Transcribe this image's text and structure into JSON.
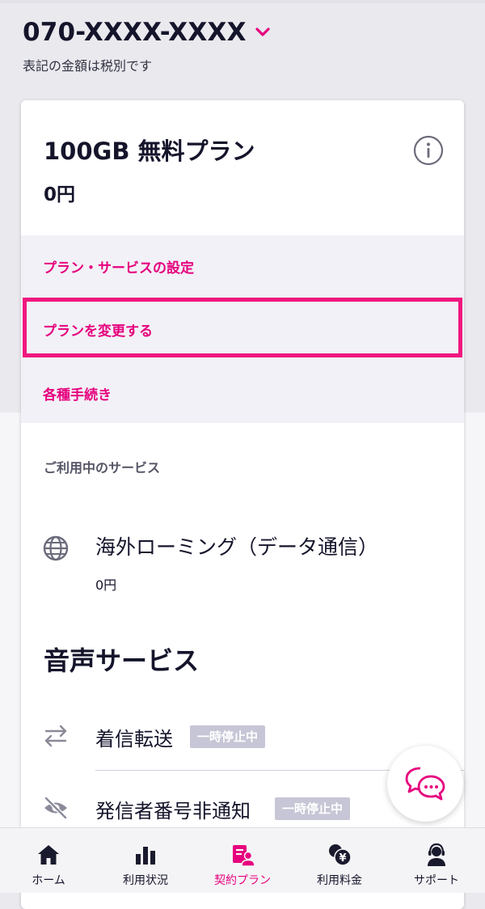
{
  "header": {
    "phone_number": "070-XXXX-XXXX",
    "tax_note": "表記の金額は税別です"
  },
  "plan": {
    "name": "100GB 無料プラン",
    "price": "0円"
  },
  "menu": {
    "items": [
      {
        "label": "プラン・サービスの設定"
      },
      {
        "label": "プランを変更する"
      },
      {
        "label": "各種手続き"
      }
    ],
    "highlighted_index": 1
  },
  "services": {
    "section_label": "ご利用中のサービス",
    "roaming": {
      "name": "海外ローミング（データ通信）",
      "price": "0円"
    }
  },
  "voice": {
    "title": "音声サービス",
    "items": [
      {
        "name": "着信転送",
        "badge": "一時停止中",
        "icon": "arrows-swap-icon"
      },
      {
        "name": "発信者番号非通知",
        "badge": "一時停止中",
        "icon": "eye-off-icon"
      }
    ]
  },
  "bottom_nav": {
    "items": [
      {
        "label": "ホーム",
        "icon": "home-icon"
      },
      {
        "label": "利用状況",
        "icon": "bar-chart-icon"
      },
      {
        "label": "契約プラン",
        "icon": "contract-icon"
      },
      {
        "label": "利用料金",
        "icon": "yen-coins-icon"
      },
      {
        "label": "サポート",
        "icon": "support-agent-icon"
      }
    ],
    "active_index": 2
  },
  "colors": {
    "accent": "#e6007e",
    "highlight_border": "#f0177f",
    "badge_bg": "#c7c6d6",
    "menu_bg": "#f2f1f7",
    "text_dark": "#14142b"
  }
}
